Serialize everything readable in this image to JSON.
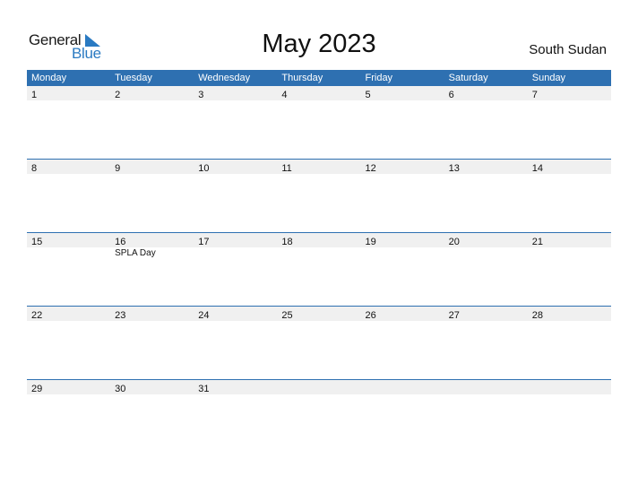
{
  "logo": {
    "word1": "General",
    "word2": "Blue"
  },
  "title": "May 2023",
  "country": "South Sudan",
  "colors": {
    "header_bg": "#2e70b1",
    "row_bg": "#f0f0f0",
    "logo_blue": "#2a7ac2"
  },
  "weekdays": [
    "Monday",
    "Tuesday",
    "Wednesday",
    "Thursday",
    "Friday",
    "Saturday",
    "Sunday"
  ],
  "weeks": [
    {
      "days": [
        "1",
        "2",
        "3",
        "4",
        "5",
        "6",
        "7"
      ],
      "events": [
        "",
        "",
        "",
        "",
        "",
        "",
        ""
      ]
    },
    {
      "days": [
        "8",
        "9",
        "10",
        "11",
        "12",
        "13",
        "14"
      ],
      "events": [
        "",
        "",
        "",
        "",
        "",
        "",
        ""
      ]
    },
    {
      "days": [
        "15",
        "16",
        "17",
        "18",
        "19",
        "20",
        "21"
      ],
      "events": [
        "",
        "SPLA Day",
        "",
        "",
        "",
        "",
        ""
      ]
    },
    {
      "days": [
        "22",
        "23",
        "24",
        "25",
        "26",
        "27",
        "28"
      ],
      "events": [
        "",
        "",
        "",
        "",
        "",
        "",
        ""
      ]
    },
    {
      "days": [
        "29",
        "30",
        "31",
        "",
        "",
        "",
        ""
      ],
      "events": [
        "",
        "",
        "",
        "",
        "",
        "",
        ""
      ]
    }
  ]
}
